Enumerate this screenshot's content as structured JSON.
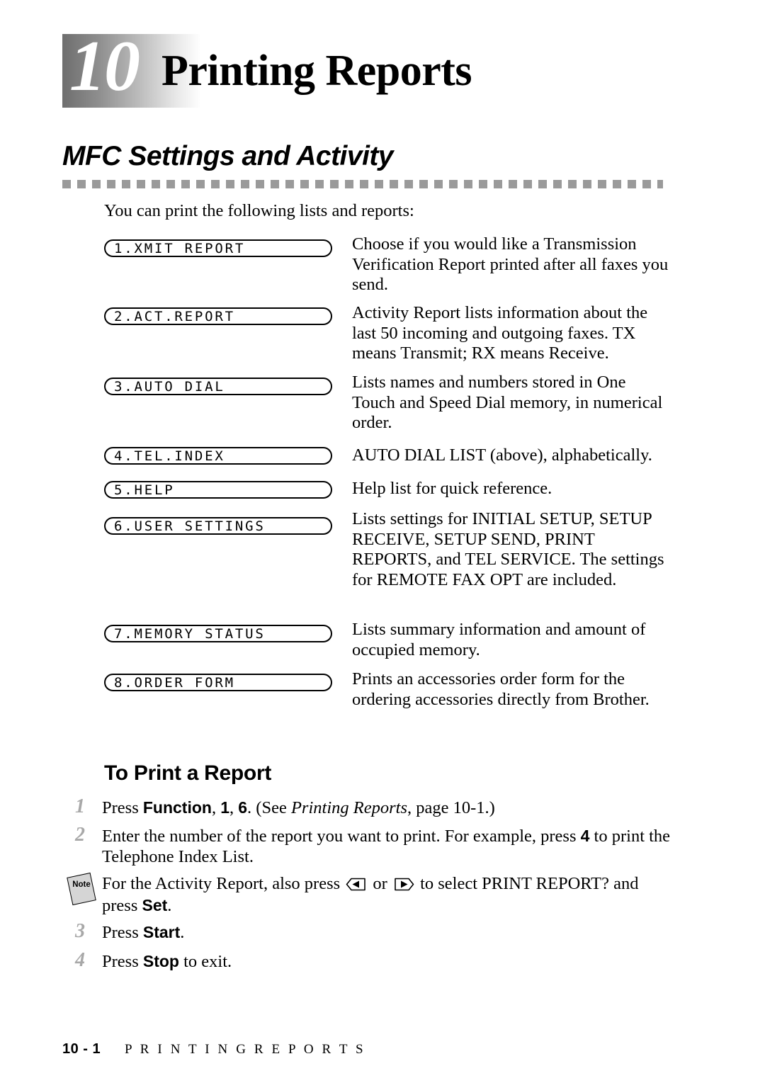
{
  "chapter": {
    "number": "10",
    "title": "Printing Reports"
  },
  "section": {
    "heading": "MFC Settings and Activity",
    "intro": "You can print the following lists and reports:"
  },
  "reports": [
    {
      "lcd": "1.XMIT REPORT",
      "description": "Choose if you would like a Transmission Verification Report printed after all faxes you send."
    },
    {
      "lcd": "2.ACT.REPORT",
      "description": "Activity Report lists information about the last 50 incoming and outgoing faxes. TX means Transmit; RX means Receive."
    },
    {
      "lcd": "3.AUTO DIAL",
      "description": "Lists names and numbers stored in One Touch and Speed Dial memory, in numerical order."
    },
    {
      "lcd": "4.TEL.INDEX",
      "description": "AUTO DIAL LIST (above), alphabetically."
    },
    {
      "lcd": "5.HELP",
      "description": "Help list for quick reference."
    },
    {
      "lcd": "6.USER SETTINGS",
      "description": "Lists settings for INITIAL SETUP, SETUP RECEIVE, SETUP SEND, PRINT REPORTS, and TEL SERVICE. The settings for REMOTE FAX OPT are included."
    },
    {
      "lcd": "7.MEMORY STATUS",
      "description": "Lists summary information and amount of occupied memory."
    },
    {
      "lcd": "8.ORDER FORM",
      "description": "Prints an accessories order form for the ordering accessories directly from Brother."
    }
  ],
  "procedure": {
    "heading": "To Print a Report",
    "steps": [
      {
        "number": "1",
        "parts": [
          {
            "text": "Press ",
            "style": "normal"
          },
          {
            "text": "Function",
            "style": "bold"
          },
          {
            "text": ", ",
            "style": "normal"
          },
          {
            "text": "1",
            "style": "bold"
          },
          {
            "text": ", ",
            "style": "normal"
          },
          {
            "text": "6",
            "style": "bold"
          },
          {
            "text": ". (See ",
            "style": "normal"
          },
          {
            "text": "Printing Reports",
            "style": "italic"
          },
          {
            "text": ", page 10-1.)",
            "style": "normal"
          }
        ]
      },
      {
        "number": "2",
        "parts": [
          {
            "text": "Enter the number of the report you want to print.  For example, press ",
            "style": "normal"
          },
          {
            "text": "4",
            "style": "bold"
          },
          {
            "text": " to print the Telephone Index List.",
            "style": "normal"
          }
        ]
      },
      {
        "number": "3",
        "parts": [
          {
            "text": "Press ",
            "style": "normal"
          },
          {
            "text": "Start",
            "style": "bold"
          },
          {
            "text": ".",
            "style": "normal"
          }
        ]
      },
      {
        "number": "4",
        "parts": [
          {
            "text": "Press ",
            "style": "normal"
          },
          {
            "text": "Stop",
            "style": "bold"
          },
          {
            "text": " to exit.",
            "style": "normal"
          }
        ]
      }
    ],
    "note": {
      "label": "Note",
      "parts": [
        {
          "text": "For the Activity Report, also press ",
          "style": "normal"
        },
        {
          "text": "left-arrow-key-icon",
          "style": "icon"
        },
        {
          "text": " or ",
          "style": "normal"
        },
        {
          "text": "right-arrow-key-icon",
          "style": "icon"
        },
        {
          "text": " to select PRINT REPORT? and press ",
          "style": "normal"
        },
        {
          "text": "Set",
          "style": "bold"
        },
        {
          "text": ".",
          "style": "normal"
        }
      ]
    }
  },
  "footer": {
    "page": "10 - 1",
    "title": "P R I N T I N G   R E P O R T S"
  },
  "colors": {
    "chapter_box_dark": "#6e6e6e",
    "divider_gray": "#9a9a9a",
    "step_number_gray": "#a8a8a8",
    "note_icon_fill": "#d5d5d5",
    "text": "#000000"
  },
  "layout": {
    "lcd_tops": [
      338,
      434,
      533,
      631,
      679,
      730,
      882,
      951
    ],
    "desc_tops": [
      331,
      428,
      526,
      629,
      676,
      719,
      875,
      945
    ],
    "step_tops": [
      1126,
      1166,
      1302,
      1343
    ]
  }
}
